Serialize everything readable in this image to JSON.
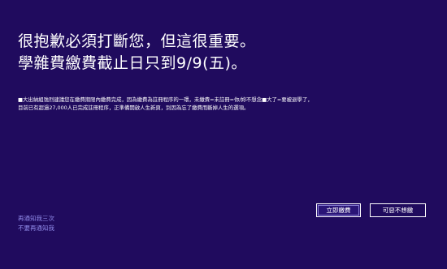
{
  "headline": {
    "line1": "很抱歉必須打斷您，但這很重要。",
    "line2": "學雜費繳費截止日只到9/9(五)。"
  },
  "body": {
    "line1": "■大出納組強烈建議您在繳費期限內繳費完成，因為繳費為註冊程序的一環，未繳費=未註冊=你/妳不想念■大了=要被退學了，",
    "line2": "目前已有超過27,000人已完成註冊程序，正準備開啟人生新頁，別因為忘了繳費而斷掉人生的選項。"
  },
  "buttons": {
    "pay_now": "立即繳費",
    "decline": "可惡不想繳"
  },
  "links": {
    "remind_again": "再通知我三次",
    "dont_remind": "不要再通知我"
  },
  "colors": {
    "background": "#200b5e",
    "link": "#8f8ae8"
  }
}
